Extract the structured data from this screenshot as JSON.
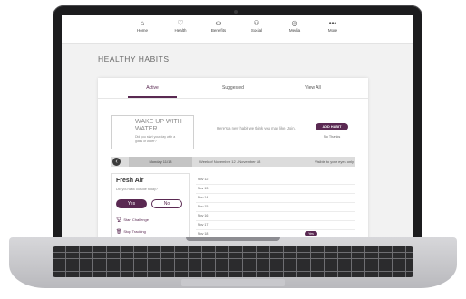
{
  "nav": {
    "items": [
      {
        "label": "Home",
        "icon": "⌂",
        "icon_name": "home-icon"
      },
      {
        "label": "Health",
        "icon": "♡",
        "icon_name": "heart-icon"
      },
      {
        "label": "Benefits",
        "icon": "⛀",
        "icon_name": "coins-icon"
      },
      {
        "label": "Social",
        "icon": "⚇",
        "icon_name": "people-icon"
      },
      {
        "label": "Media",
        "icon": "◎",
        "icon_name": "media-icon"
      },
      {
        "label": "More",
        "icon": "•••",
        "icon_name": "more-icon"
      }
    ]
  },
  "page": {
    "title": "HEALTHY HABITS"
  },
  "tabs": {
    "active": "Active",
    "suggested": "Suggested",
    "view_all": "View All"
  },
  "suggestion": {
    "habit_title": "WAKE UP WITH WATER",
    "habit_subtitle": "Did you start your day with a glass of water?",
    "prompt": "Here's a new habit we think you may like. Join.",
    "add_label": "ADD HABIT",
    "no_thanks": "No Thanks"
  },
  "week": {
    "day": "Monday 11/18",
    "range": "Week of November 12 - November 18",
    "visibility": "Visible to your eyes only"
  },
  "fresh_air": {
    "title": "Fresh Air",
    "question": "Did you walk outside today?",
    "yes": "Yes",
    "no": "No",
    "start_challenge": "Start Challenge",
    "stop_tracking": "Stop Tracking"
  },
  "days": [
    {
      "label": "Nov 12",
      "badge": ""
    },
    {
      "label": "Nov 13",
      "badge": ""
    },
    {
      "label": "Nov 14",
      "badge": ""
    },
    {
      "label": "Nov 15",
      "badge": ""
    },
    {
      "label": "Nov 16",
      "badge": ""
    },
    {
      "label": "Nov 17",
      "badge": ""
    },
    {
      "label": "Nov 18",
      "badge": "Yes"
    }
  ],
  "colors": {
    "accent": "#5a2952",
    "background": "#f2f2f2"
  }
}
